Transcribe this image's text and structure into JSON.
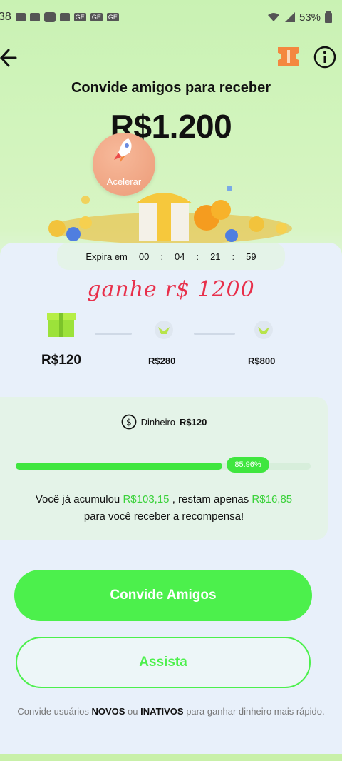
{
  "status_bar": {
    "time": "38",
    "battery": "53%",
    "icons": [
      "chat-icon",
      "lock-icon",
      "notification-icon",
      "sim-icon",
      "ge-badge",
      "ge-badge",
      "ge-badge",
      "wifi-icon",
      "signal-icon",
      "battery-icon"
    ]
  },
  "header": {
    "back_icon": "arrow-left-icon",
    "ticket_icon": "ticket-icon",
    "info_icon": "info-icon",
    "title": "Convide amigos para receber",
    "amount": "R$1.200"
  },
  "accelerate": {
    "label": "Acelerar"
  },
  "timer": {
    "label": "Expira em",
    "hours": "00",
    "minutes": "04",
    "seconds": "21",
    "centis": "59"
  },
  "promo_text": "ganhe r$ 1200",
  "rewards": [
    {
      "label": "R$120",
      "active": true
    },
    {
      "label": "R$280",
      "active": false
    },
    {
      "label": "R$800",
      "active": false
    }
  ],
  "cash_row": {
    "icon": "dollar-circle-icon",
    "label": "Dinheiro",
    "value": "R$120"
  },
  "progress": {
    "percent_label": "85.96%",
    "fraction": 0.7
  },
  "accumulated": {
    "prefix": "Você já acumulou",
    "earned": "R$103,15",
    "middle": ", restam apenas",
    "remaining": "R$16,85",
    "suffix": "para você receber a recompensa!"
  },
  "buttons": {
    "invite": "Convide Amigos",
    "watch": "Assista"
  },
  "footer": {
    "part1": "Convide usuários",
    "new_word": "NOVOS",
    "part2": "ou",
    "inactive_word": "INATIVOS",
    "part3": "para ganhar dinheiro mais rápido."
  },
  "colors": {
    "accent_green": "#4cf04c",
    "promo_red": "#e8304b",
    "amount_green": "#3bd23b"
  }
}
